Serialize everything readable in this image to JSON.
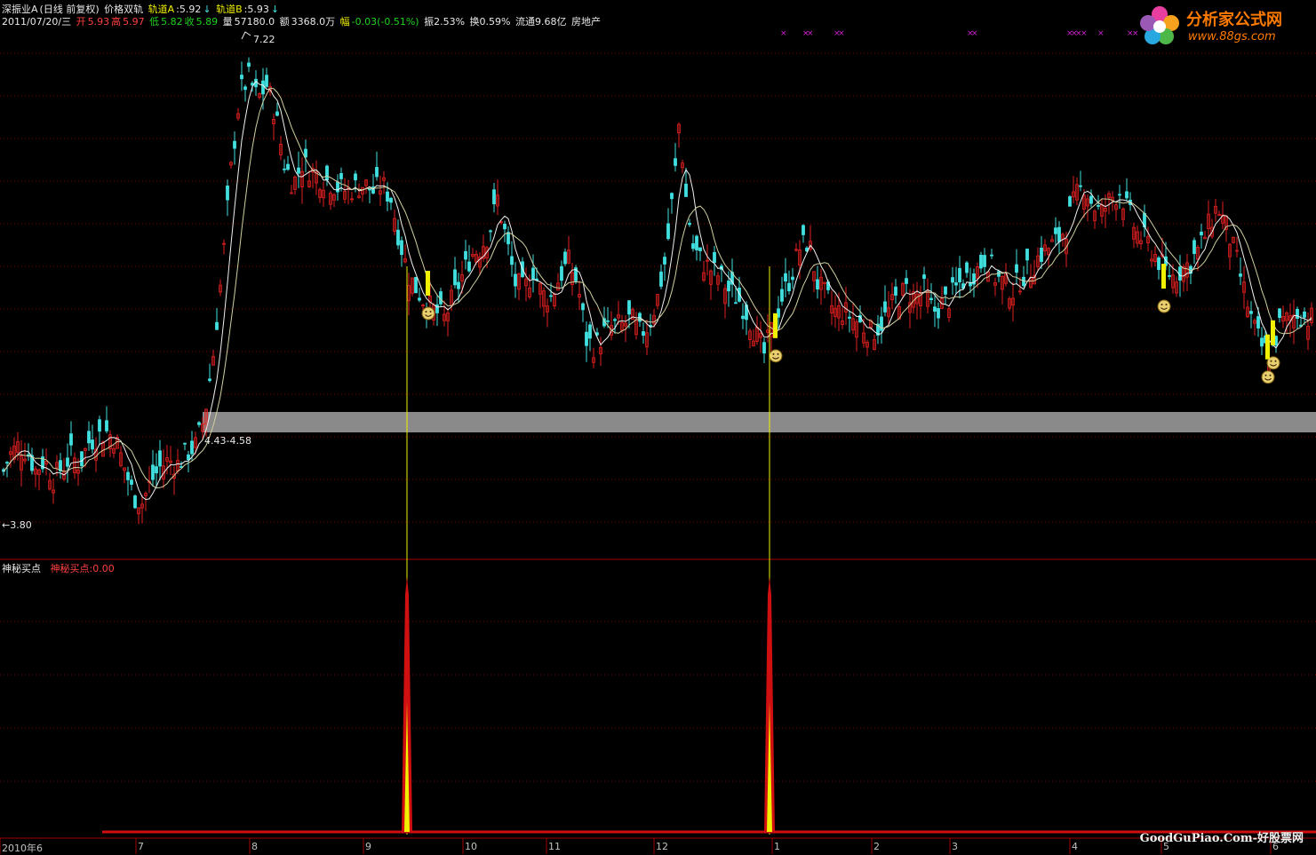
{
  "header": {
    "stock_name": "深振业A",
    "period": "(日线 前复权)",
    "indicator": "价格双轨",
    "trackA_label": "轨道A",
    "trackA_value": ":5.92",
    "trackB_label": "轨道B",
    "trackB_value": ":5.93",
    "arrow": "↓",
    "date": "2011/07/20/三",
    "open_label": "开",
    "open_value": "5.93",
    "high_label": "高",
    "high_value": "5.97",
    "low_label": "低",
    "low_value": "5.82",
    "close_label": "收",
    "close_value": "5.89",
    "volume_label": "量",
    "volume_value": "57180.0",
    "amount_label": "额",
    "amount_value": "3368.0万",
    "change_label": "幅",
    "change_value": "-0.03(-0.51%)",
    "amplitude": "振2.53%",
    "turnover": "换0.59%",
    "float_shares": "流通9.68亿",
    "sector": "房地产"
  },
  "brand": {
    "title": "分析家公式网",
    "url": "www.88gs.com"
  },
  "indicator_panel": {
    "name": "神秘买点",
    "value_text": "神秘买点:0.00"
  },
  "watermark": "GoodGuPiao.Com-好股票网",
  "colors": {
    "background": "#000000",
    "up": "#e02020",
    "down": "#40e0e0",
    "ma": "#f0f0f0",
    "signal": "#f0f000",
    "indicator": "#d01010",
    "band": "#8a8a8a",
    "grid": "#800000"
  },
  "chart_data": {
    "type": "candlestick",
    "x_start": "2010/06",
    "x_end": "2011/07/20",
    "x_ticks": [
      "2010年6",
      "7",
      "8",
      "9",
      "10",
      "11",
      "12",
      "1",
      "2",
      "3",
      "4",
      "5",
      "6"
    ],
    "y_range": [
      3.8,
      7.22
    ],
    "annotations": {
      "max_label": "7.22",
      "min_label": "←3.80",
      "band_label": "4.43-4.58",
      "band": [
        4.43,
        4.58
      ]
    },
    "close_path": [
      [
        0,
        4.1
      ],
      [
        10,
        4.28
      ],
      [
        20,
        4.35
      ],
      [
        30,
        4.32
      ],
      [
        40,
        4.18
      ],
      [
        50,
        4.25
      ],
      [
        60,
        4.12
      ],
      [
        70,
        4.2
      ],
      [
        80,
        4.28
      ],
      [
        90,
        4.22
      ],
      [
        100,
        4.38
      ],
      [
        110,
        4.42
      ],
      [
        120,
        4.45
      ],
      [
        130,
        4.4
      ],
      [
        140,
        4.2
      ],
      [
        150,
        4.0
      ],
      [
        160,
        3.95
      ],
      [
        170,
        4.1
      ],
      [
        180,
        4.2
      ],
      [
        190,
        4.25
      ],
      [
        200,
        4.22
      ],
      [
        210,
        4.3
      ],
      [
        220,
        4.35
      ],
      [
        230,
        4.55
      ],
      [
        240,
        5.0
      ],
      [
        250,
        5.6
      ],
      [
        260,
        6.3
      ],
      [
        270,
        6.85
      ],
      [
        280,
        6.95
      ],
      [
        290,
        6.8
      ],
      [
        300,
        6.9
      ],
      [
        310,
        6.7
      ],
      [
        320,
        6.35
      ],
      [
        330,
        6.2
      ],
      [
        340,
        6.35
      ],
      [
        350,
        6.3
      ],
      [
        360,
        6.25
      ],
      [
        370,
        6.22
      ],
      [
        380,
        6.18
      ],
      [
        390,
        6.15
      ],
      [
        400,
        6.18
      ],
      [
        410,
        6.2
      ],
      [
        420,
        6.15
      ],
      [
        430,
        6.2
      ],
      [
        440,
        6.1
      ],
      [
        450,
        5.8
      ],
      [
        460,
        5.55
      ],
      [
        470,
        5.45
      ],
      [
        480,
        5.35
      ],
      [
        490,
        5.3
      ],
      [
        500,
        5.25
      ],
      [
        510,
        5.4
      ],
      [
        520,
        5.55
      ],
      [
        530,
        5.7
      ],
      [
        540,
        5.75
      ],
      [
        550,
        5.85
      ],
      [
        560,
        6.1
      ],
      [
        570,
        5.8
      ],
      [
        580,
        5.5
      ],
      [
        590,
        5.45
      ],
      [
        600,
        5.6
      ],
      [
        610,
        5.42
      ],
      [
        620,
        5.4
      ],
      [
        630,
        5.55
      ],
      [
        640,
        5.65
      ],
      [
        650,
        5.5
      ],
      [
        660,
        5.1
      ],
      [
        670,
        5.05
      ],
      [
        680,
        5.15
      ],
      [
        690,
        5.2
      ],
      [
        700,
        5.2
      ],
      [
        710,
        5.25
      ],
      [
        720,
        5.15
      ],
      [
        730,
        5.2
      ],
      [
        740,
        5.4
      ],
      [
        750,
        5.7
      ],
      [
        760,
        6.3
      ],
      [
        765,
        6.7
      ],
      [
        770,
        6.2
      ],
      [
        780,
        5.75
      ],
      [
        790,
        5.65
      ],
      [
        800,
        5.6
      ],
      [
        810,
        5.55
      ],
      [
        820,
        5.45
      ],
      [
        830,
        5.4
      ],
      [
        840,
        5.3
      ],
      [
        850,
        5.15
      ],
      [
        860,
        5.0
      ],
      [
        870,
        5.2
      ],
      [
        880,
        5.4
      ],
      [
        890,
        5.55
      ],
      [
        900,
        5.75
      ],
      [
        910,
        5.8
      ],
      [
        920,
        5.5
      ],
      [
        930,
        5.4
      ],
      [
        940,
        5.3
      ],
      [
        950,
        5.3
      ],
      [
        960,
        5.25
      ],
      [
        970,
        5.2
      ],
      [
        980,
        5.15
      ],
      [
        990,
        5.2
      ],
      [
        1000,
        5.3
      ],
      [
        1010,
        5.4
      ],
      [
        1020,
        5.45
      ],
      [
        1030,
        5.4
      ],
      [
        1040,
        5.45
      ],
      [
        1050,
        5.3
      ],
      [
        1060,
        5.35
      ],
      [
        1070,
        5.4
      ],
      [
        1080,
        5.5
      ],
      [
        1090,
        5.55
      ],
      [
        1100,
        5.6
      ],
      [
        1110,
        5.7
      ],
      [
        1120,
        5.55
      ],
      [
        1130,
        5.5
      ],
      [
        1140,
        5.45
      ],
      [
        1150,
        5.55
      ],
      [
        1160,
        5.6
      ],
      [
        1170,
        5.7
      ],
      [
        1180,
        5.75
      ],
      [
        1190,
        5.8
      ],
      [
        1200,
        5.9
      ],
      [
        1210,
        6.1
      ],
      [
        1220,
        6.2
      ],
      [
        1230,
        6.05
      ],
      [
        1240,
        6.0
      ],
      [
        1250,
        6.1
      ],
      [
        1260,
        6.15
      ],
      [
        1270,
        6.0
      ],
      [
        1280,
        5.85
      ],
      [
        1290,
        5.8
      ],
      [
        1300,
        5.7
      ],
      [
        1310,
        5.6
      ],
      [
        1320,
        5.55
      ],
      [
        1330,
        5.6
      ],
      [
        1340,
        5.65
      ],
      [
        1350,
        5.75
      ],
      [
        1360,
        5.9
      ],
      [
        1370,
        6.05
      ],
      [
        1380,
        5.9
      ],
      [
        1390,
        5.7
      ],
      [
        1400,
        5.45
      ],
      [
        1410,
        5.2
      ],
      [
        1420,
        5.05
      ],
      [
        1430,
        5.0
      ],
      [
        1440,
        5.2
      ],
      [
        1450,
        5.25
      ],
      [
        1460,
        5.3
      ],
      [
        1470,
        5.25
      ],
      [
        1480,
        5.25
      ]
    ],
    "buy_signals": [
      {
        "x": 458,
        "value": 1.0
      },
      {
        "x": 866,
        "value": 1.0
      }
    ],
    "signal_markers": [
      {
        "x": 482,
        "price": 5.4
      },
      {
        "x": 873,
        "price": 5.1
      },
      {
        "x": 1310,
        "price": 5.45
      },
      {
        "x": 1433,
        "price": 5.05
      },
      {
        "x": 1427,
        "price": 4.95
      }
    ],
    "indicator_series": {
      "name": "神秘买点",
      "baseline": 0.0,
      "peaks": [
        {
          "x": 458,
          "value": 1.0
        },
        {
          "x": 866,
          "value": 1.0
        }
      ]
    }
  }
}
